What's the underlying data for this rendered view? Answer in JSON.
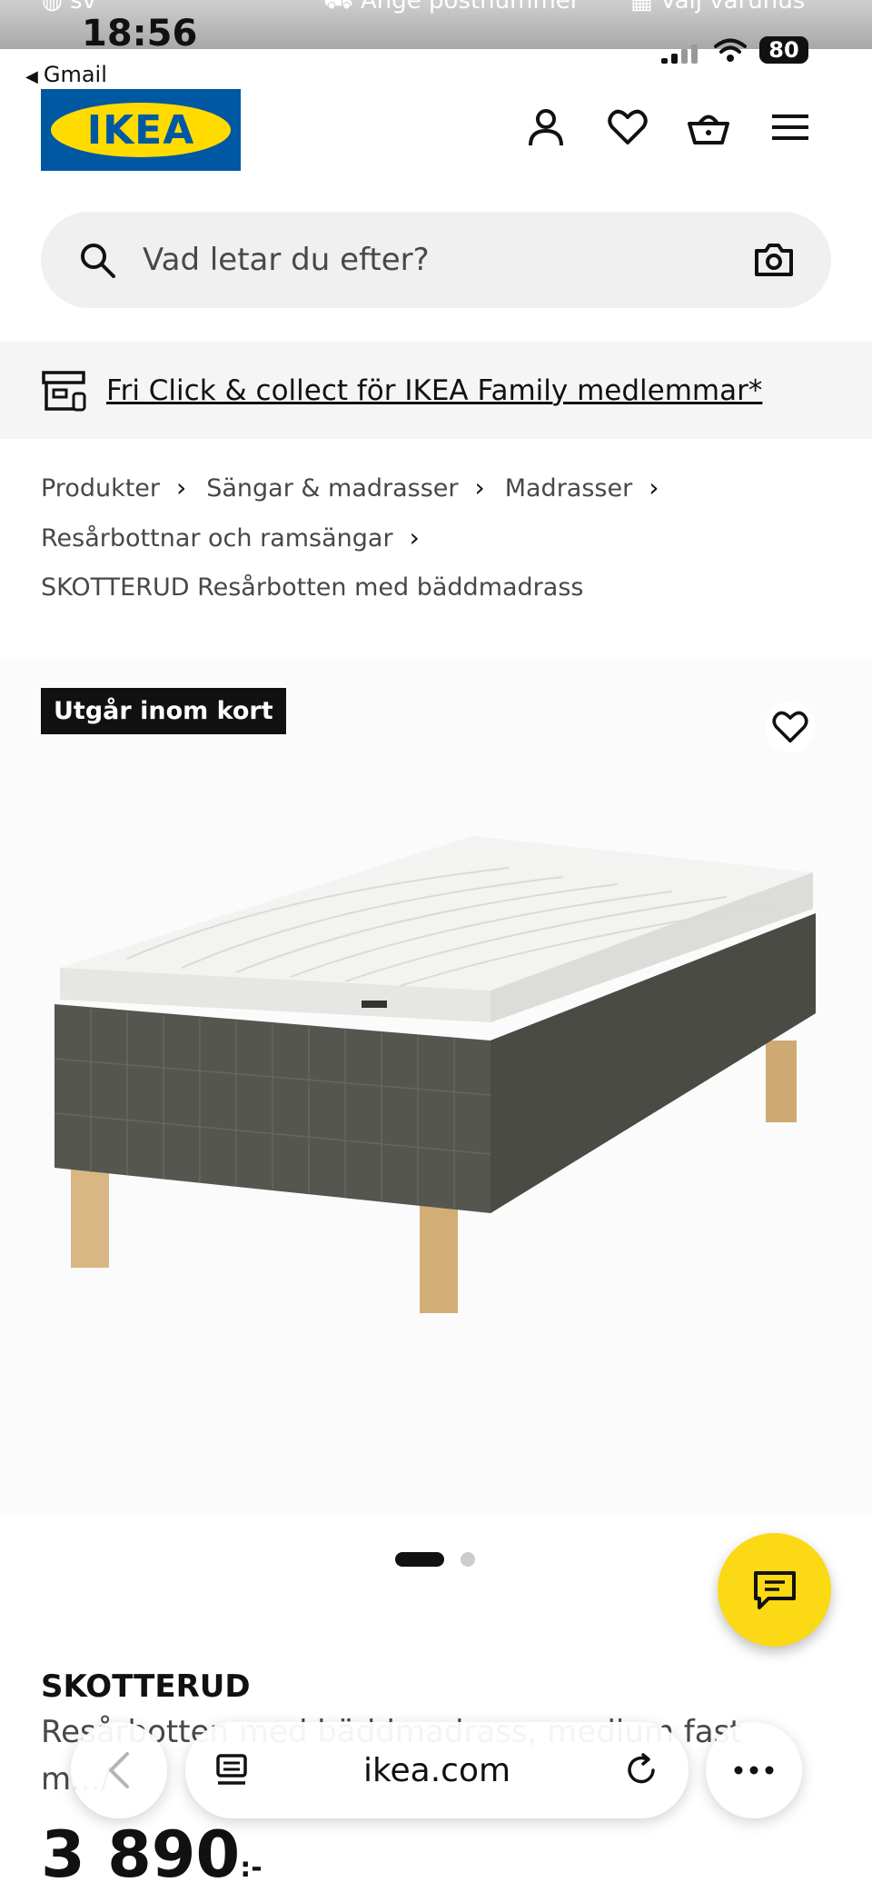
{
  "status_bar": {
    "time": "18:56",
    "battery": "80",
    "back_app": "Gmail",
    "peek_language": "sv",
    "peek_delivery": "Ange postnummer",
    "peek_store": "Välj varuhus"
  },
  "header": {
    "logo_text": "IKEA",
    "icons": [
      "user-icon",
      "heart-icon",
      "basket-icon",
      "menu-icon"
    ]
  },
  "search": {
    "placeholder": "Vad letar du efter?"
  },
  "promo": {
    "text": "Fri Click & collect för IKEA Family medlemmar*"
  },
  "breadcrumb": {
    "items": [
      "Produkter",
      "Sängar & madrasser",
      "Madrasser",
      "Resårbottnar och ramsängar"
    ],
    "current": "SKOTTERUD Resårbotten med bäddmadrass"
  },
  "product": {
    "badge": "Utgår inom kort",
    "name": "SKOTTERUD",
    "description": "Resårbotten med bäddmadrass, medium fast m.../",
    "price": "3 890",
    "currency": ":-",
    "image_count": 2,
    "active_image": 1
  },
  "browser": {
    "url": "ikea.com"
  },
  "colors": {
    "ikea_blue": "#0058a3",
    "ikea_yellow": "#ffdb00",
    "chat_yellow": "#fbd914"
  }
}
